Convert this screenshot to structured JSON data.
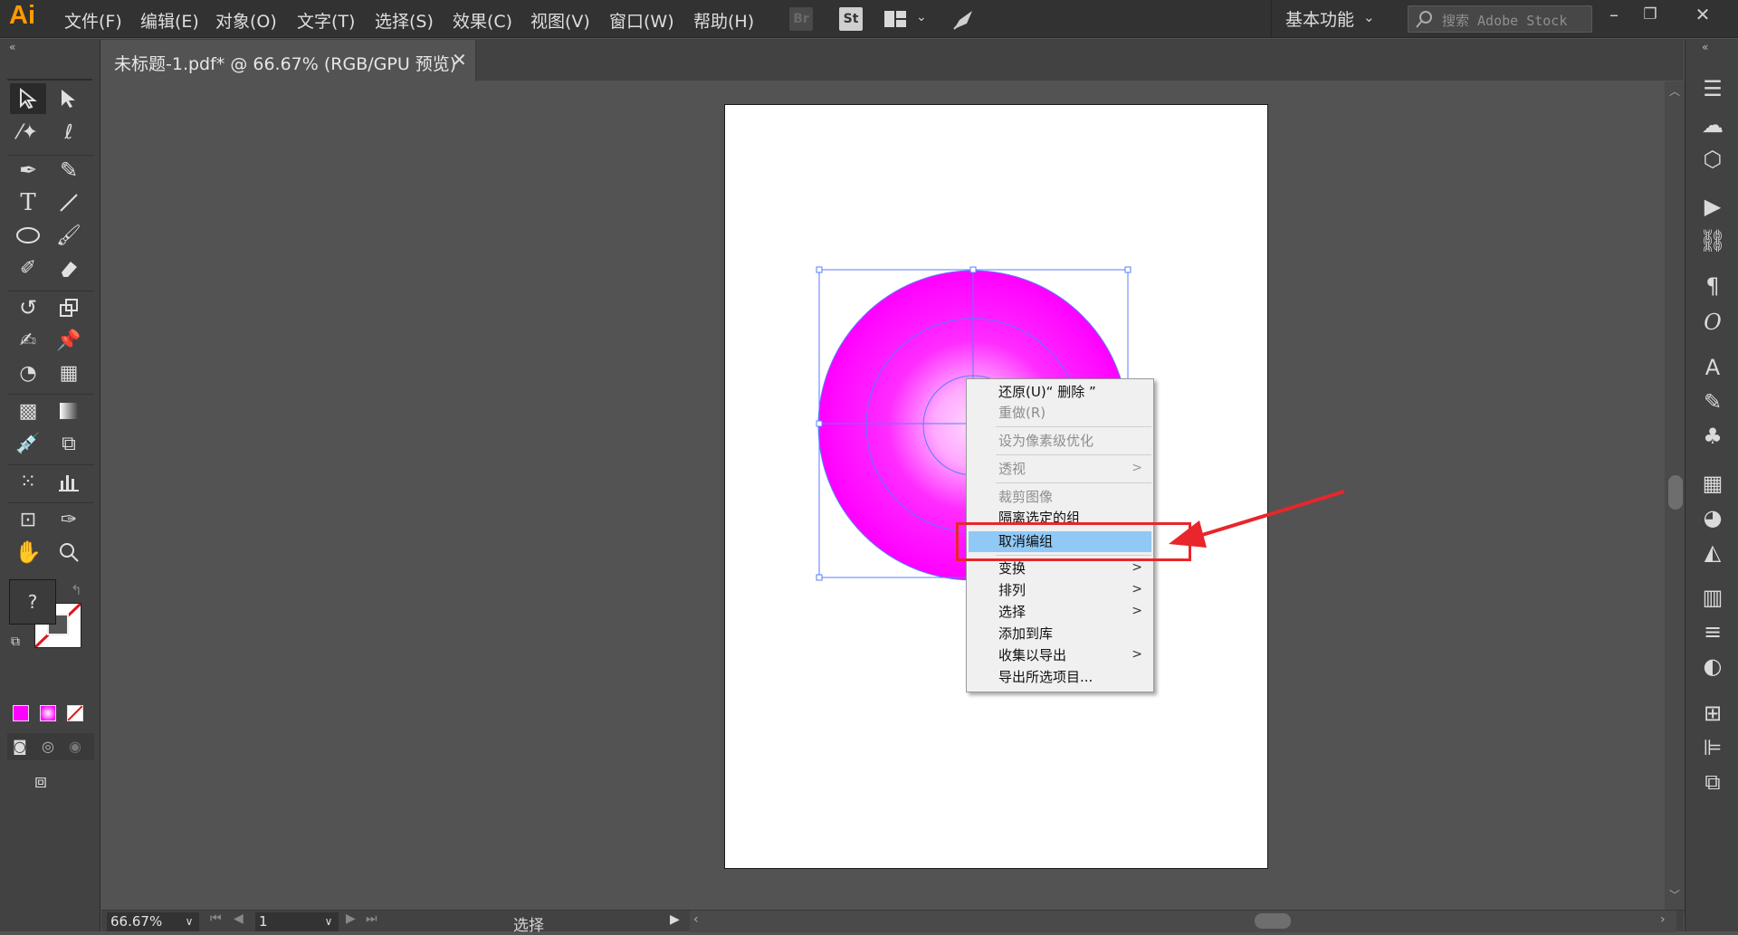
{
  "app": {
    "logo": "Ai",
    "accent": "#ff9a00"
  },
  "menu": [
    "文件(F)",
    "编辑(E)",
    "对象(O)",
    "文字(T)",
    "选择(S)",
    "效果(C)",
    "视图(V)",
    "窗口(W)",
    "帮助(H)"
  ],
  "toolbar_icons": {
    "bridge": "Br",
    "stock": "St"
  },
  "workspace": {
    "label": "基本功能"
  },
  "search": {
    "placeholder": "搜索 Adobe Stock"
  },
  "window_buttons": [
    "minimize-icon",
    "restore-icon",
    "close-icon"
  ],
  "document_tab": {
    "title": "未标题-1.pdf* @ 66.67% (RGB/GPU 预览)",
    "close": "✕"
  },
  "swatches": {
    "fill_icon": "?",
    "fill_color": "#ff00ff"
  },
  "context_menu": {
    "items": [
      {
        "label": "还原(U)“ 删除 ”",
        "enabled": true
      },
      {
        "label": "重做(R)",
        "enabled": false
      },
      {
        "label": "设为像素级优化",
        "enabled": false
      },
      {
        "label": "透视",
        "enabled": false,
        "submenu": true
      },
      {
        "label": "裁剪图像",
        "enabled": false
      },
      {
        "label": "隔离选定的组",
        "enabled": true
      },
      {
        "label": "取消编组",
        "enabled": true,
        "highlighted": true
      },
      {
        "label": "变换",
        "enabled": true,
        "submenu": true
      },
      {
        "label": "排列",
        "enabled": true,
        "submenu": true
      },
      {
        "label": "选择",
        "enabled": true,
        "submenu": true
      },
      {
        "label": "添加到库",
        "enabled": true
      },
      {
        "label": "收集以导出",
        "enabled": true,
        "submenu": true
      },
      {
        "label": "导出所选项目...",
        "enabled": true
      }
    ],
    "submenu_glyph": ">"
  },
  "statusbar": {
    "zoom": "66.67%",
    "page": "1",
    "tool": "选择"
  },
  "annotation": {
    "color": "#e8262b"
  }
}
